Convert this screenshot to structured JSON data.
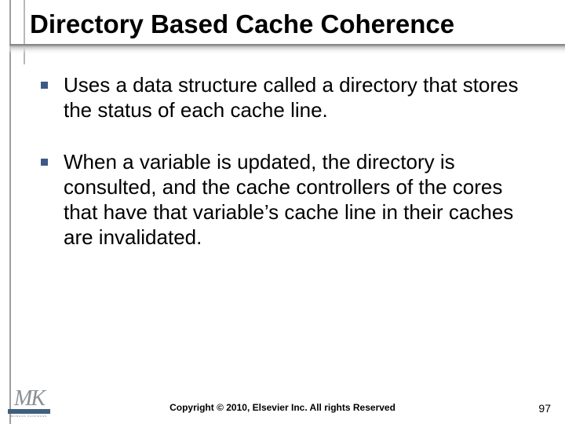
{
  "title": "Directory Based Cache Coherence",
  "bullets": [
    "Uses a data structure called a directory that stores the status of each cache line.",
    "When a variable is updated, the directory is consulted, and the cache controllers of the cores that have that variable’s cache line in their caches are invalidated."
  ],
  "footer": {
    "logo_text": "MK",
    "logo_subtext": "MORGAN KAUFMANN",
    "copyright": "Copyright © 2010, Elsevier Inc. All rights Reserved",
    "page_number": "97"
  },
  "colors": {
    "bullet_square": "#3d5a87",
    "rule_grey": "#9e9e9e",
    "logo_text": "#8a8f94",
    "logo_bar": "#3f5f7f"
  }
}
